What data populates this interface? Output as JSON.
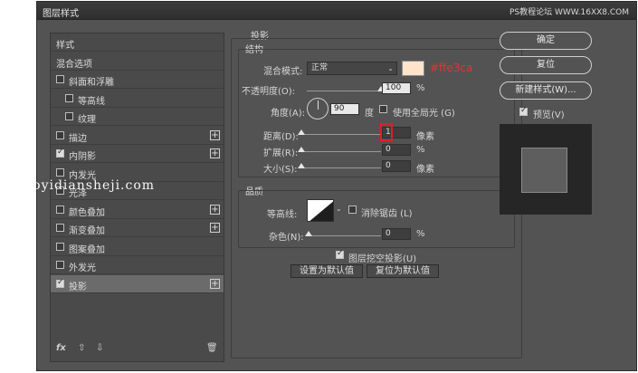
{
  "window": {
    "title": "图层样式",
    "watermark": "PS教程论坛 WWW.16XX8.COM"
  },
  "left_panel": {
    "rows": [
      {
        "label": "样式",
        "checkbox": false,
        "checked": false,
        "plus": false,
        "indent": 0
      },
      {
        "label": "混合选项",
        "checkbox": false,
        "checked": false,
        "plus": false,
        "indent": 0
      },
      {
        "label": "斜面和浮雕",
        "checkbox": true,
        "checked": false,
        "plus": false,
        "indent": 0
      },
      {
        "label": "等高线",
        "checkbox": true,
        "checked": false,
        "plus": false,
        "indent": 1
      },
      {
        "label": "纹理",
        "checkbox": true,
        "checked": false,
        "plus": false,
        "indent": 1
      },
      {
        "label": "描边",
        "checkbox": true,
        "checked": false,
        "plus": true,
        "indent": 0
      },
      {
        "label": "内阴影",
        "checkbox": true,
        "checked": true,
        "plus": true,
        "indent": 0
      },
      {
        "label": "内发光",
        "checkbox": true,
        "checked": false,
        "plus": false,
        "indent": 0
      },
      {
        "label": "光泽",
        "checkbox": true,
        "checked": false,
        "plus": false,
        "indent": 0
      },
      {
        "label": "颜色叠加",
        "checkbox": true,
        "checked": false,
        "plus": true,
        "indent": 0
      },
      {
        "label": "渐变叠加",
        "checkbox": true,
        "checked": false,
        "plus": true,
        "indent": 0
      },
      {
        "label": "图案叠加",
        "checkbox": true,
        "checked": false,
        "plus": false,
        "indent": 0
      },
      {
        "label": "外发光",
        "checkbox": true,
        "checked": false,
        "plus": false,
        "indent": 0
      },
      {
        "label": "投影",
        "checkbox": true,
        "checked": true,
        "plus": true,
        "indent": 0,
        "selected": true
      }
    ],
    "footer": {
      "fx": "fx",
      "up": "⇧",
      "down": "⇩",
      "trash": "🗑"
    }
  },
  "drop_shadow": {
    "section_title": "投影",
    "structure_title": "结构",
    "blend_mode_label": "混合模式:",
    "blend_mode_value": "正常",
    "color_hex": "#ffe3ca",
    "color_note": "#ffe3ca",
    "opacity_label": "不透明度(O):",
    "opacity_value": "100",
    "opacity_unit": "%",
    "opacity_fraction": 1.0,
    "angle_label": "角度(A):",
    "angle_value": "90",
    "angle_unit": "度",
    "global_light_label": "使用全局光 (G)",
    "distance_label": "距离(D):",
    "distance_value": "1",
    "distance_unit": "像素",
    "spread_label": "扩展(R):",
    "spread_value": "0",
    "spread_unit": "%",
    "size_label": "大小(S):",
    "size_value": "0",
    "size_unit": "像素",
    "quality_title": "品质",
    "contour_label": "等高线:",
    "antialias_label": "消除锯齿 (L)",
    "noise_label": "杂色(N):",
    "noise_value": "0",
    "noise_unit": "%",
    "knockout_label": "图层挖空投影(U)",
    "make_default": "设置为默认值",
    "reset_default": "复位为默认值"
  },
  "right_panel": {
    "ok": "确定",
    "reset": "复位",
    "new_style": "新建样式(W)...",
    "preview_label": "预览(V)",
    "preview_checked": true
  },
  "url_watermark": "w.haoyidiansheji.com"
}
